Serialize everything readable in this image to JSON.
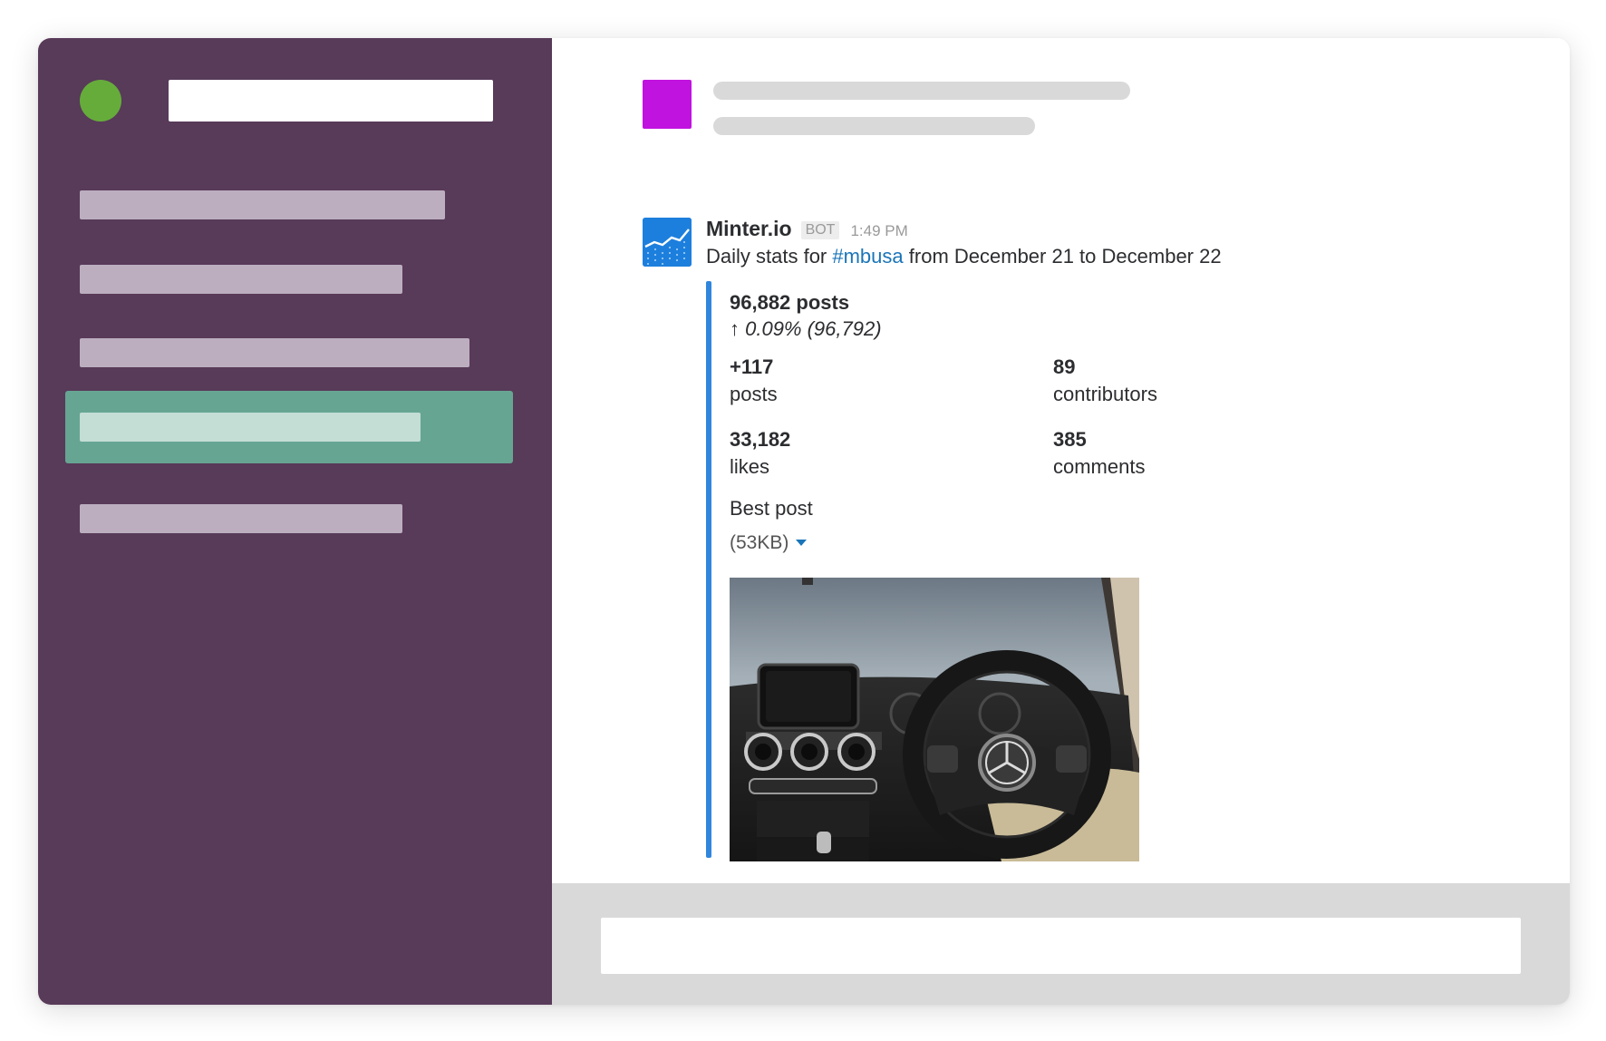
{
  "message": {
    "bot_name": "Minter.io",
    "bot_badge": "BOT",
    "time": "1:49 PM",
    "text_prefix": "Daily stats for ",
    "channel_link": "#mbusa",
    "text_suffix": " from December 21 to December 22"
  },
  "attachment": {
    "total_posts": "96,882 posts",
    "change": "↑ 0.09% (96,792)",
    "stats": [
      {
        "value": "+117",
        "label": "posts"
      },
      {
        "value": "89",
        "label": "contributors"
      },
      {
        "value": "33,182",
        "label": "likes"
      },
      {
        "value": "385",
        "label": "comments"
      }
    ],
    "best_post_title": "Best post",
    "best_post_size": "(53KB)"
  },
  "colors": {
    "sidebar": "#583a59",
    "presence": "#66ac3b",
    "active_item": "#67a593",
    "channel_avatar": "#c013df",
    "bot_avatar": "#1d7fdd",
    "attachment_border": "#2f86dc",
    "link": "#1a75b8"
  },
  "icons": {
    "bot_avatar": "chart-line-icon",
    "size_toggle": "caret-down-icon"
  },
  "composer": {
    "value": "",
    "placeholder": ""
  }
}
